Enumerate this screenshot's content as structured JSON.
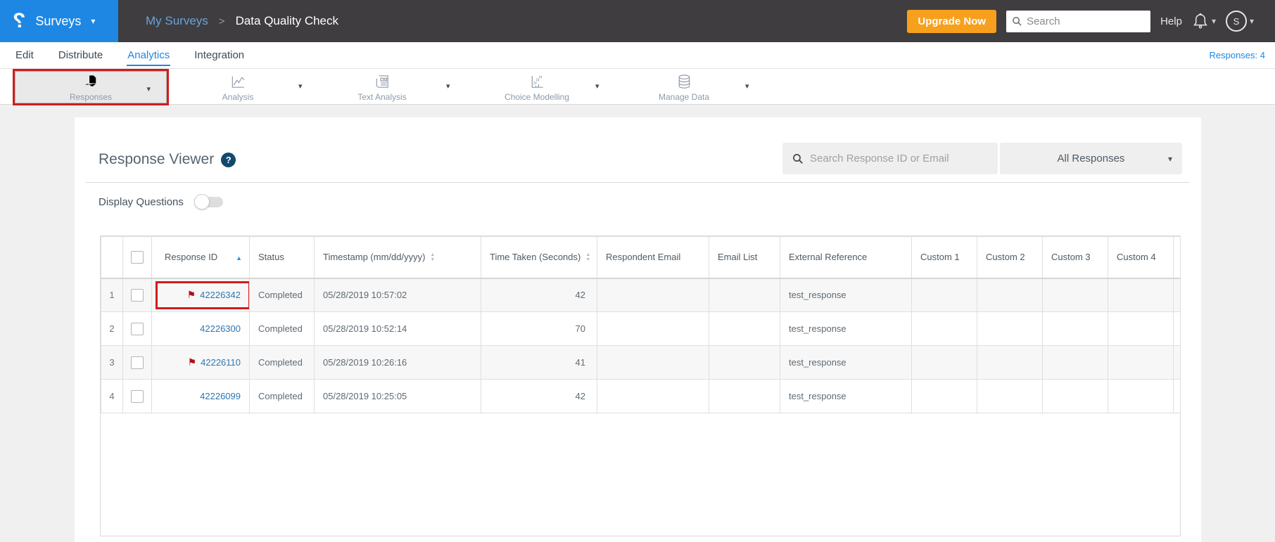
{
  "header": {
    "product_label": "Surveys",
    "breadcrumb": {
      "parent": "My Surveys",
      "separator": ">",
      "current": "Data Quality Check"
    },
    "upgrade_button": "Upgrade Now",
    "search_placeholder": "Search",
    "help_label": "Help",
    "avatar_initial": "S"
  },
  "tabs": {
    "items": [
      "Edit",
      "Distribute",
      "Analytics",
      "Integration"
    ],
    "active": "Analytics",
    "responses_count": "Responses: 4"
  },
  "toolbar": {
    "items": [
      {
        "label": "Responses",
        "selected": true,
        "annotated": true
      },
      {
        "label": "Analysis",
        "selected": false
      },
      {
        "label": "Text Analysis",
        "selected": false
      },
      {
        "label": "Choice Modelling",
        "selected": false
      },
      {
        "label": "Manage Data",
        "selected": false
      }
    ]
  },
  "panel": {
    "title": "Response Viewer",
    "search_placeholder": "Search Response ID or Email",
    "filter_value": "All Responses",
    "display_questions_label": "Display Questions",
    "display_questions_state": "off"
  },
  "table": {
    "columns": [
      {
        "label": "",
        "sort": "none"
      },
      {
        "label": "",
        "sort": "none"
      },
      {
        "label": "Response ID",
        "sort": "asc"
      },
      {
        "label": "Status",
        "sort": "none"
      },
      {
        "label": "Timestamp (mm/dd/yyyy)",
        "sort": "both"
      },
      {
        "label": "Time Taken (Seconds)",
        "sort": "both"
      },
      {
        "label": "Respondent Email",
        "sort": "none"
      },
      {
        "label": "Email List",
        "sort": "none"
      },
      {
        "label": "External Reference",
        "sort": "none"
      },
      {
        "label": "Custom 1",
        "sort": "none"
      },
      {
        "label": "Custom 2",
        "sort": "none"
      },
      {
        "label": "Custom 3",
        "sort": "none"
      },
      {
        "label": "Custom 4",
        "sort": "none"
      }
    ],
    "rows": [
      {
        "num": "1",
        "id": "42226342",
        "flagged": true,
        "annotated": true,
        "status": "Completed",
        "timestamp": "05/28/2019 10:57:02",
        "time_taken": "42",
        "respondent_email": "",
        "email_list": "",
        "external_reference": "test_response",
        "custom1": "",
        "custom2": "",
        "custom3": "",
        "custom4": ""
      },
      {
        "num": "2",
        "id": "42226300",
        "flagged": false,
        "annotated": false,
        "status": "Completed",
        "timestamp": "05/28/2019 10:52:14",
        "time_taken": "70",
        "respondent_email": "",
        "email_list": "",
        "external_reference": "test_response",
        "custom1": "",
        "custom2": "",
        "custom3": "",
        "custom4": ""
      },
      {
        "num": "3",
        "id": "42226110",
        "flagged": true,
        "annotated": false,
        "status": "Completed",
        "timestamp": "05/28/2019 10:26:16",
        "time_taken": "41",
        "respondent_email": "",
        "email_list": "",
        "external_reference": "test_response",
        "custom1": "",
        "custom2": "",
        "custom3": "",
        "custom4": ""
      },
      {
        "num": "4",
        "id": "42226099",
        "flagged": false,
        "annotated": false,
        "status": "Completed",
        "timestamp": "05/28/2019 10:25:05",
        "time_taken": "42",
        "respondent_email": "",
        "email_list": "",
        "external_reference": "test_response",
        "custom1": "",
        "custom2": "",
        "custom3": "",
        "custom4": ""
      }
    ]
  },
  "icons": {
    "flag": "⚑",
    "caret_down": "▾",
    "sort_asc": "▲",
    "sort_up": "▲",
    "sort_down": "▼",
    "logo_glyph": "?",
    "help_glyph": "?"
  },
  "colors": {
    "brand_blue": "#1e87e4",
    "topbar_dark": "#3f3d3f",
    "upgrade_orange": "#f7a01d",
    "annotation_red": "#cf1d1d",
    "link_blue": "#2d76b5",
    "flag_red": "#b01212",
    "body_gray": "#f0f0f0"
  }
}
